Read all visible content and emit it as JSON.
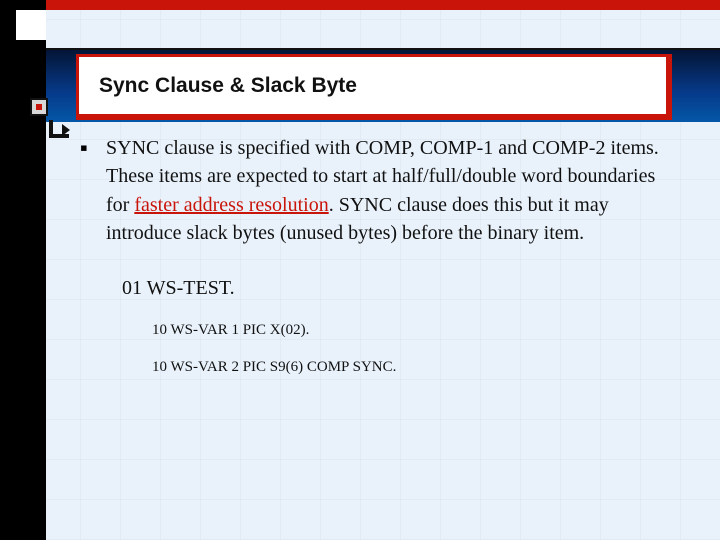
{
  "title": "Sync Clause & Slack Byte",
  "body": {
    "pre": "SYNC clause is specified with COMP, COMP-1 and COMP-2 items. These items are expected to start at half/full/double word boundaries for ",
    "emph": "faster address resolution",
    "post": ". SYNC clause does this but it may introduce slack bytes (unused bytes) before the binary item."
  },
  "code": {
    "line1": "01 WS-TEST.",
    "line2": "10 WS-VAR 1 PIC X(02).",
    "line3": "10 WS-VAR 2 PIC S9(6) COMP SYNC."
  },
  "colors": {
    "accentRed": "#c9140a",
    "bgLight": "#e9f2fb",
    "bandBlueTop": "#041536"
  }
}
